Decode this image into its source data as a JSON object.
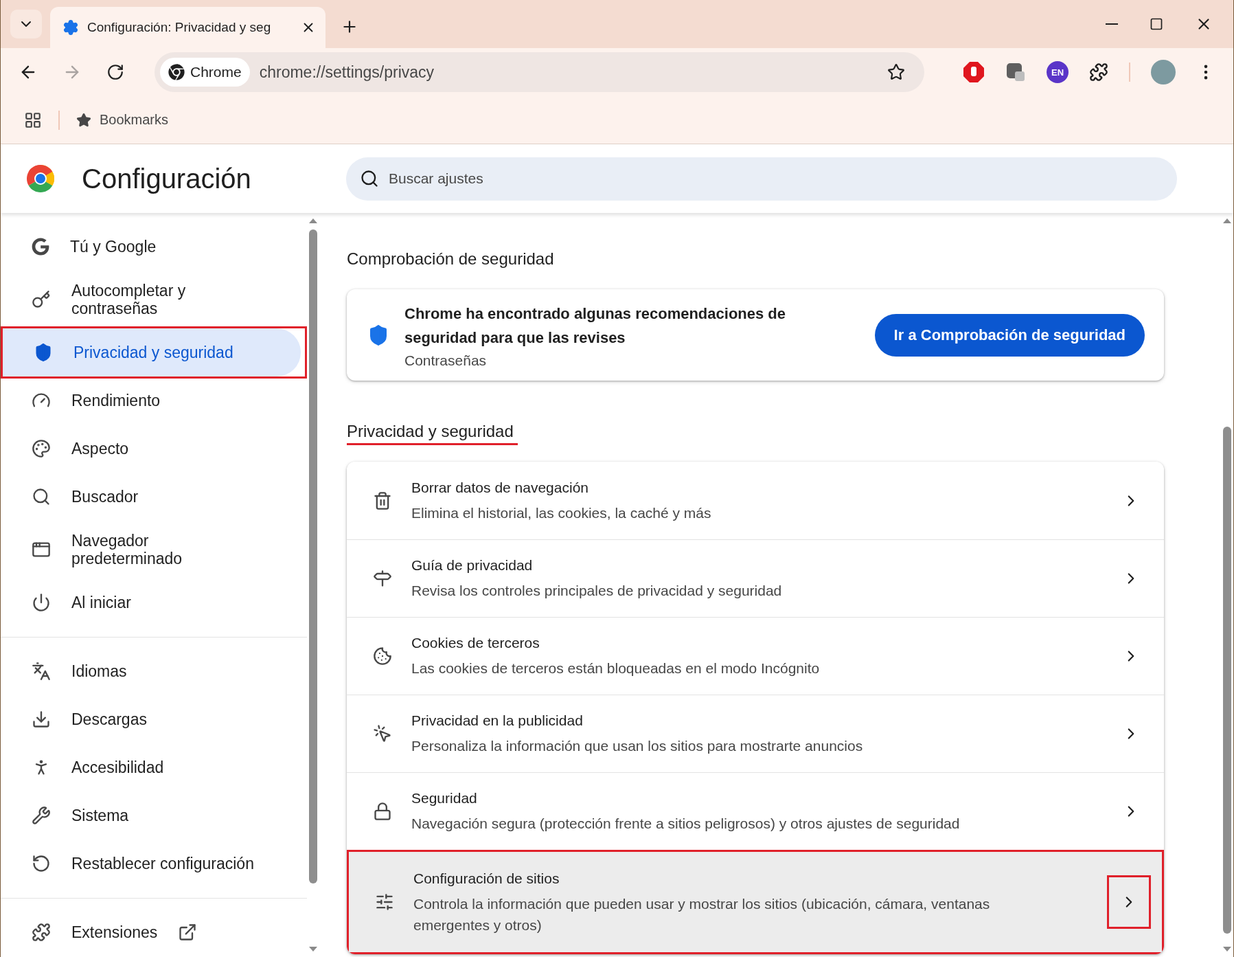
{
  "tabs": [
    {
      "title": "Configuración: Privacidad y seg",
      "selected": true
    }
  ],
  "toolbar": {
    "forward_disabled": true,
    "chip": "Chrome",
    "url": "chrome://settings/privacy",
    "extension_badge": "EN"
  },
  "bookmarks_bar": {
    "label": "Bookmarks"
  },
  "header": {
    "title": "Configuración",
    "search": {
      "placeholder": "Buscar ajustes"
    }
  },
  "sidebar": {
    "groups": [
      {
        "items": [
          {
            "label": "Tú y Google",
            "kind": "page",
            "selected": false,
            "highlighted": false
          },
          {
            "label": "Autocompletar y contraseñas",
            "kind": "page",
            "selected": false,
            "highlighted": false
          },
          {
            "label": "Privacidad y seguridad",
            "kind": "page",
            "selected": true,
            "highlighted": true
          },
          {
            "label": "Rendimiento",
            "kind": "page",
            "selected": false,
            "highlighted": false
          },
          {
            "label": "Aspecto",
            "kind": "page",
            "selected": false,
            "highlighted": false
          },
          {
            "label": "Buscador",
            "kind": "page",
            "selected": false,
            "highlighted": false
          },
          {
            "label": "Navegador predeterminado",
            "kind": "page",
            "selected": false,
            "highlighted": false
          },
          {
            "label": "Al iniciar",
            "kind": "page",
            "selected": false,
            "highlighted": false
          }
        ]
      },
      {
        "items": [
          {
            "label": "Idiomas",
            "kind": "page",
            "selected": false,
            "highlighted": false
          },
          {
            "label": "Descargas",
            "kind": "page",
            "selected": false,
            "highlighted": false
          },
          {
            "label": "Accesibilidad",
            "kind": "page",
            "selected": false,
            "highlighted": false
          },
          {
            "label": "Sistema",
            "kind": "page",
            "selected": false,
            "highlighted": false
          },
          {
            "label": "Restablecer configuración",
            "kind": "page",
            "selected": false,
            "highlighted": false
          }
        ]
      },
      {
        "items": [
          {
            "label": "Extensiones",
            "kind": "external",
            "selected": false,
            "highlighted": false
          }
        ]
      }
    ]
  },
  "safety_check": {
    "heading": "Comprobación de seguridad",
    "message": "Chrome ha encontrado algunas recomendaciones de seguridad para que las revises",
    "detail": "Contraseñas",
    "button": "Ir a Comprobación de seguridad"
  },
  "privacy_section": {
    "heading": "Privacidad y seguridad",
    "underlined": true,
    "rows": [
      {
        "title": "Borrar datos de navegación",
        "subtitle": "Elimina el historial, las cookies, la caché y más",
        "hovered": false,
        "highlighted": false
      },
      {
        "title": "Guía de privacidad",
        "subtitle": "Revisa los controles principales de privacidad y seguridad",
        "hovered": false,
        "highlighted": false
      },
      {
        "title": "Cookies de terceros",
        "subtitle": "Las cookies de terceros están bloqueadas en el modo Incógnito",
        "hovered": false,
        "highlighted": false
      },
      {
        "title": "Privacidad en la publicidad",
        "subtitle": "Personaliza la información que usan los sitios para mostrarte anuncios",
        "hovered": false,
        "highlighted": false
      },
      {
        "title": "Seguridad",
        "subtitle": "Navegación segura (protección frente a sitios peligrosos) y otros ajustes de seguridad",
        "hovered": false,
        "highlighted": false
      },
      {
        "title": "Configuración de sitios",
        "subtitle": "Controla la información que pueden usar y mostrar los sitios (ubicación, cámara, ventanas emergentes y otros)",
        "hovered": true,
        "highlighted": true
      }
    ]
  }
}
